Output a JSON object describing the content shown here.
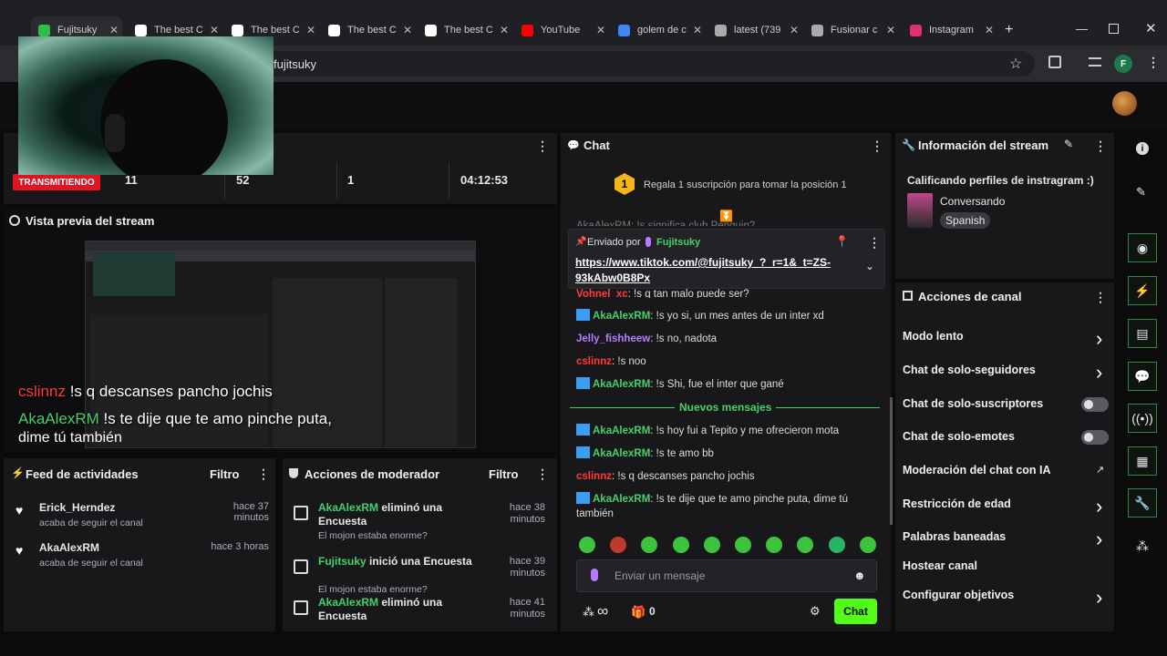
{
  "browser": {
    "tabs": [
      {
        "label": "Fujitsuky",
        "color": "#2bbf4a"
      },
      {
        "label": "The best C",
        "color": "#ffffff"
      },
      {
        "label": "The best C",
        "color": "#ffffff"
      },
      {
        "label": "The best C",
        "color": "#ffffff"
      },
      {
        "label": "The best C",
        "color": "#ffffff"
      },
      {
        "label": "YouTube",
        "color": "#ff0000"
      },
      {
        "label": "golem de c",
        "color": "#4285f4"
      },
      {
        "label": "latest (739",
        "color": "#aaaaaa"
      },
      {
        "label": "Fusionar c",
        "color": "#aaaaaa"
      },
      {
        "label": "Instagram",
        "color": "#e1306c"
      }
    ],
    "url": "fujitsuky",
    "profile_letter": "F"
  },
  "stats": {
    "status": "TRANSMITIENDO",
    "items": [
      {
        "value": "11"
      },
      {
        "value": "52"
      },
      {
        "value": "1"
      },
      {
        "value": "04:12:53"
      }
    ]
  },
  "preview": {
    "title": "Vista previa del stream"
  },
  "overlay": {
    "line1_user": "cslinnz",
    "line1_text": "!s q descanses pancho jochis",
    "line2_user": "AkaAlexRM",
    "line2_text": "!s te dije que te amo pinche puta,",
    "line3_text": "dime tú también"
  },
  "activity": {
    "title": "Feed de actividades",
    "filter": "Filtro",
    "items": [
      {
        "user": "Erick_Herndez",
        "time": "hace 37 minutos",
        "desc": "acaba de seguir el canal"
      },
      {
        "user": "AkaAlexRM",
        "time": "hace 3 horas",
        "desc": "acaba de seguir el canal"
      }
    ]
  },
  "modactions": {
    "title": "Acciones de moderador",
    "filter": "Filtro",
    "items": [
      {
        "user": "AkaAlexRM",
        "action": " eliminó una",
        "action2": "Encuesta",
        "time": "hace 38",
        "time2": "minutos",
        "desc": "El mojon estaba enorme?"
      },
      {
        "user": "Fujitsuky",
        "action": " inició una Encuesta",
        "action2": "",
        "time": "hace 39 minutos",
        "time2": "",
        "desc": "El mojon estaba enorme?"
      },
      {
        "user": "AkaAlexRM",
        "action": " eliminó una",
        "action2": "Encuesta",
        "time": "hace 41",
        "time2": "minutos",
        "desc": ""
      }
    ]
  },
  "chat": {
    "title": "Chat",
    "gift_text": "Regala 1 suscripción para tomar la posición 1",
    "gift_num": "1",
    "pinned_label": "Enviado por",
    "pinned_user": "Fujitsuky",
    "pinned_link1": "https://www.tiktok.com/@fujitsuky_?_r=1&_t=ZS-",
    "pinned_link2": "93kAbw0B8Px",
    "partial_top": "AkaAlexRM: !s significa club Penguin?",
    "partial2_user": "Vohnel_xc",
    "partial2_text": ": !s q tan malo puede ser?",
    "messages": [
      {
        "user": "AkaAlexRM",
        "text": ": !s yo si, un mes antes de un inter xd",
        "color": "#45d06a",
        "mod": true
      },
      {
        "user": "Jelly_fishheew",
        "text": ": !s no, nadota",
        "color": "#b57cff",
        "mod": false
      },
      {
        "user": "cslinnz",
        "text": ": !s noo",
        "color": "#ff3b3b",
        "mod": false
      },
      {
        "user": "AkaAlexRM",
        "text": ": !s Shi, fue el inter que gané",
        "color": "#45d06a",
        "mod": true
      }
    ],
    "new_label": "Nuevos mensajes",
    "new_messages": [
      {
        "user": "AkaAlexRM",
        "text": ": !s hoy fui a Tepito y me ofrecieron mota",
        "color": "#45d06a",
        "mod": true
      },
      {
        "user": "AkaAlexRM",
        "text": ": !s te amo bb",
        "color": "#45d06a",
        "mod": true
      },
      {
        "user": "cslinnz",
        "text": ": !s q descanses pancho jochis",
        "color": "#ff3b3b",
        "mod": false
      },
      {
        "user": "AkaAlexRM",
        "text": ": !s te dije que te amo pinche puta, dime tú también",
        "color": "#45d06a",
        "mod": true
      }
    ],
    "input_placeholder": "Enviar un mensaje",
    "points": "∞",
    "gifts": "0",
    "send_label": "Chat"
  },
  "streaminfo": {
    "title": "Información del stream",
    "stream_title": "Calificando perfiles de instragram :)",
    "category": "Conversando",
    "language": "Spanish"
  },
  "channelactions": {
    "title": "Acciones de canal",
    "items": [
      {
        "label": "Modo lento",
        "kind": "chevron"
      },
      {
        "label": "Chat de solo-seguidores",
        "kind": "chevron"
      },
      {
        "label": "Chat de solo-suscriptores",
        "kind": "toggle"
      },
      {
        "label": "Chat de solo-emotes",
        "kind": "toggle"
      },
      {
        "label": "Moderación del chat con IA",
        "kind": "external"
      },
      {
        "label": "Restricción de edad",
        "kind": "chevron"
      },
      {
        "label": "Palabras baneadas",
        "kind": "chevron"
      },
      {
        "label": "Hostear canal",
        "kind": "none"
      },
      {
        "label": "Configurar objetivos",
        "kind": "chevron"
      }
    ]
  }
}
